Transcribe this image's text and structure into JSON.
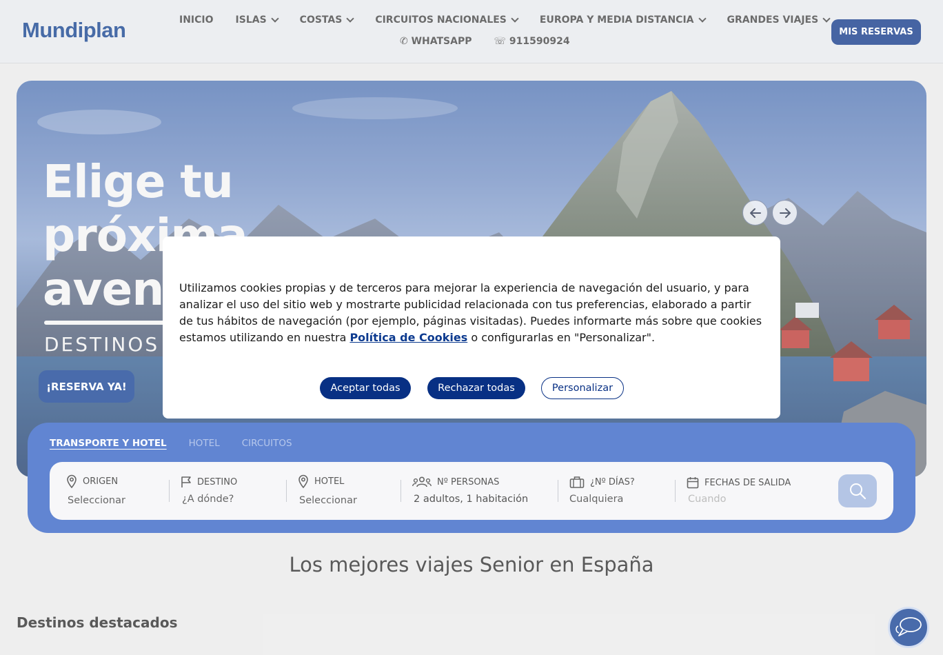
{
  "header": {
    "logo": "Mundiplan",
    "nav": [
      {
        "label": "INICIO",
        "dropdown": false
      },
      {
        "label": "ISLAS",
        "dropdown": true
      },
      {
        "label": "COSTAS",
        "dropdown": true
      },
      {
        "label": "CIRCUITOS NACIONALES",
        "dropdown": true
      },
      {
        "label": "EUROPA Y MEDIA DISTANCIA",
        "dropdown": true
      },
      {
        "label": "GRANDES VIAJES",
        "dropdown": true
      }
    ],
    "whatsapp": "✆ WHATSAPP",
    "phone": "☏ 911590924",
    "reservas_label": "MIS RESERVAS"
  },
  "hero": {
    "title_line1": "Elige tu",
    "title_line2": "próxima",
    "title_line3": "aventura",
    "subtitle": "DESTINOS EUROPA",
    "cta": "¡RESERVA YA!",
    "prev_icon": "arrow-left-icon",
    "next_icon": "arrow-right-icon"
  },
  "search": {
    "tabs": [
      {
        "label": "TRANSPORTE Y HOTEL",
        "active": true
      },
      {
        "label": "HOTEL",
        "active": false
      },
      {
        "label": "CIRCUITOS",
        "active": false
      }
    ],
    "fields": {
      "origen": {
        "label": "ORIGEN",
        "value": "Seleccionar",
        "icon": "map-pin-icon"
      },
      "destino": {
        "label": "DESTINO",
        "value": "¿A dónde?",
        "icon": "flag-icon"
      },
      "hotel": {
        "label": "HOTEL",
        "value": "Seleccionar",
        "icon": "map-pin-icon"
      },
      "personas": {
        "label": "Nº PERSONAS",
        "value": "2 adultos, 1 habitación",
        "icon": "people-icon"
      },
      "dias": {
        "label": "¿Nº DÍAS?",
        "value": "Cualquiera",
        "icon": "suitcase-icon"
      },
      "fechas": {
        "label": "FECHAS DE SALIDA",
        "placeholder": "Cuando",
        "icon": "calendar-icon"
      }
    },
    "search_icon": "search-icon"
  },
  "main": {
    "section_title": "Los mejores viajes Senior en España",
    "destinos_title": "Destinos destacados"
  },
  "cookie": {
    "text_before": "Utilizamos cookies propias y de terceros para mejorar la experiencia de navegación del usuario, y para analizar el uso del sitio web y mostrarte publicidad relacionada con tus preferencias, elaborado a partir de tus hábitos de navegación (por ejemplo, páginas visitadas). Puedes informarte más sobre que cookies estamos utilizando en nuestra ",
    "link": "Política de Cookies",
    "text_after": " o configurarlas en \"Personalizar\".",
    "accept": "Aceptar todas",
    "reject": "Rechazar todas",
    "customize": "Personalizar"
  },
  "colors": {
    "brand": "#083084",
    "panel": "#2c5cc3",
    "header_bg": "#e6e8ec"
  }
}
